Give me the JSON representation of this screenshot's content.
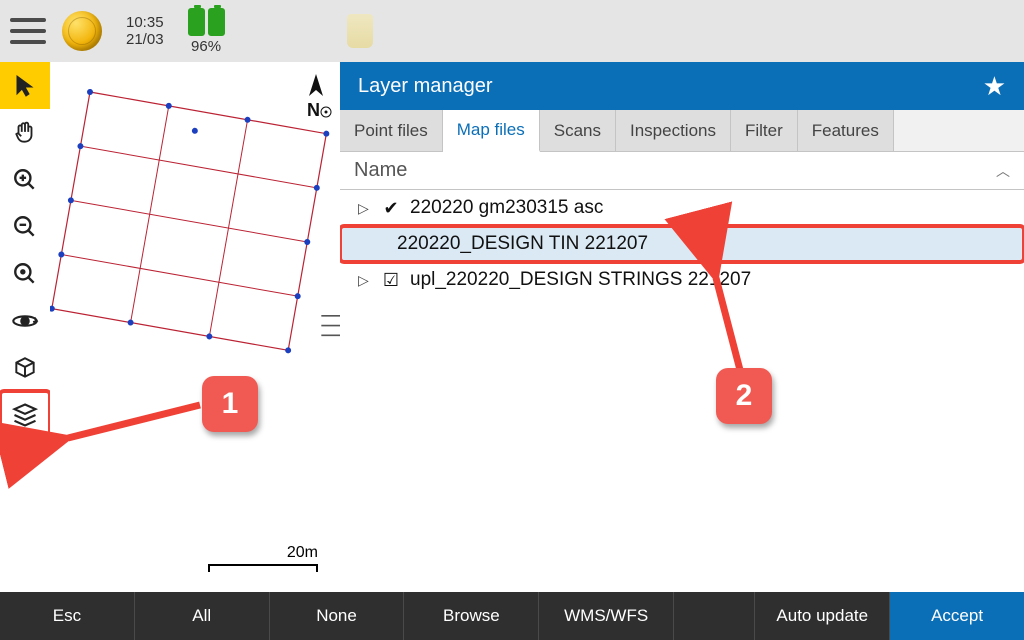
{
  "topbar": {
    "time": "10:35",
    "date": "21/03",
    "battery_pct": "96%"
  },
  "panel": {
    "title": "Layer manager",
    "tabs": [
      "Point files",
      "Map files",
      "Scans",
      "Inspections",
      "Filter",
      "Features"
    ],
    "active_tab": 1,
    "column": "Name",
    "rows": [
      {
        "expand": "▷",
        "check": "✔",
        "name": "220220 gm230315 asc"
      },
      {
        "expand": "",
        "check": "",
        "name": "220220_DESIGN TIN 221207",
        "selected": true
      },
      {
        "expand": "▷",
        "check": "☑",
        "name": "upl_220220_DESIGN STRINGS 221207"
      }
    ]
  },
  "scale": "20m",
  "bottom": [
    "Esc",
    "All",
    "None",
    "Browse",
    "WMS/WFS",
    "",
    "Auto update",
    "Accept"
  ],
  "callouts": {
    "one": "1",
    "two": "2"
  }
}
